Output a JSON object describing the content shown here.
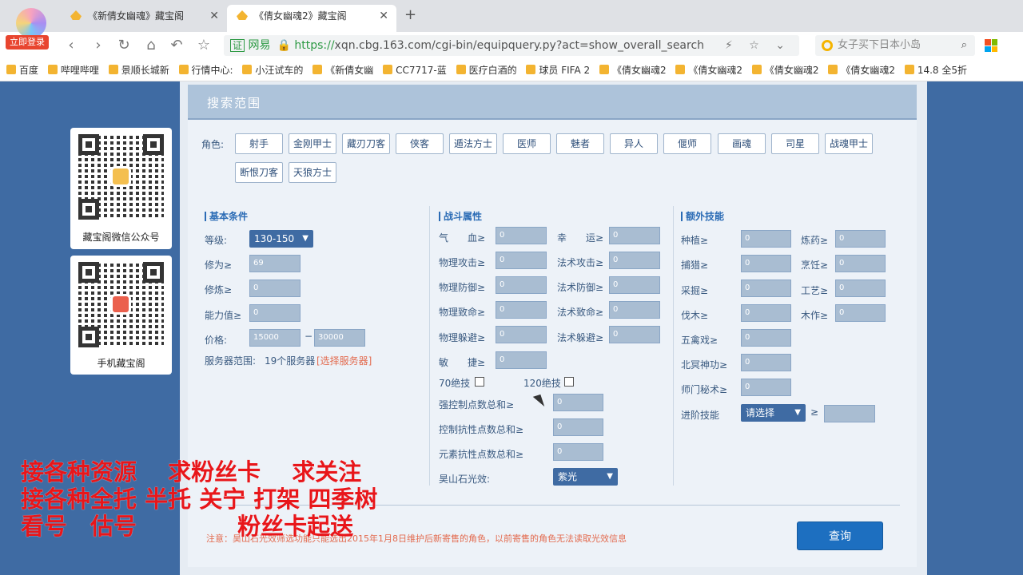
{
  "browser": {
    "login_badge": "立即登录",
    "tabs": [
      {
        "title": "《新倩女幽魂》藏宝阁",
        "close": "✕"
      },
      {
        "title": "《倩女幽魂2》藏宝阁",
        "close": "✕"
      }
    ],
    "newtab": "+",
    "nav": {
      "back": "‹",
      "forward": "›",
      "reload": "↻",
      "home": "⌂",
      "undo": "↶",
      "star": "☆"
    },
    "address": {
      "cert": "证",
      "site": "网易",
      "lock": "🔒",
      "proto": "https://",
      "host_path": "xqn.cbg.163.com/cgi-bin/equipquery.py?act=show_overall_search",
      "icons": "⚡ ☆ ⌄"
    },
    "search": {
      "placeholder": "女子买下日本小岛",
      "icon": "⌕"
    },
    "bookmarks": [
      "百度",
      "哔哩哔哩",
      "景顺长城新",
      "行情中心:",
      "小汪试车的",
      "《新倩女幽",
      "CC7717-蓝",
      "医疗白酒的",
      "球员 FIFA 2",
      "《倩女幽魂2",
      "《倩女幽魂2",
      "《倩女幽魂2",
      "《倩女幽魂2",
      "14.8 全5折"
    ]
  },
  "qr_cards": [
    {
      "label": "藏宝阁微信公众号"
    },
    {
      "label": "手机藏宝阁"
    }
  ],
  "scope": {
    "title": "搜索范围",
    "role_label": "角色:",
    "roles": [
      "射手",
      "金刚甲士",
      "藏刃刀客",
      "侠客",
      "遁法方士",
      "医师",
      "魅者",
      "异人",
      "偃师",
      "画魂",
      "司星",
      "战魂甲士",
      "断恨刀客",
      "天狼方士"
    ]
  },
  "basic": {
    "title": "基本条件",
    "level_label": "等级:",
    "level_value": "130-150",
    "cultivation_label": "修为≥",
    "cultivation_value": "69",
    "practice_label": "修炼≥",
    "practice_value": "0",
    "ability_label": "能力值≥",
    "ability_value": "0",
    "price_label": "价格:",
    "price_min": "15000",
    "price_sep": "−",
    "price_max": "30000",
    "server_label": "服务器范围:",
    "server_count": "19个服务器",
    "server_choose": "[选择服务器]"
  },
  "combat": {
    "title": "战斗属性",
    "left": [
      {
        "label": "气　　血≥",
        "value": "0"
      },
      {
        "label": "物理攻击≥",
        "value": "0"
      },
      {
        "label": "物理防御≥",
        "value": "0"
      },
      {
        "label": "物理致命≥",
        "value": "0"
      },
      {
        "label": "物理躲避≥",
        "value": "0"
      },
      {
        "label": "敏　　捷≥",
        "value": "0"
      }
    ],
    "right": [
      {
        "label": "幸　　运≥",
        "value": "0"
      },
      {
        "label": "法术攻击≥",
        "value": "0"
      },
      {
        "label": "法术防御≥",
        "value": "0"
      },
      {
        "label": "法术致命≥",
        "value": "0"
      },
      {
        "label": "法术躲避≥",
        "value": "0"
      }
    ],
    "skill70": "70绝技",
    "skill120": "120绝技",
    "control_label": "强控制点数总和≥",
    "control_value": "0",
    "resist_label": "控制抗性点数总和≥",
    "resist_value": "0",
    "element_label": "元素抗性点数总和≥",
    "element_value": "0",
    "haoshan_label": "昊山石光效:",
    "haoshan_value": "紫光"
  },
  "extra": {
    "title": "额外技能",
    "left": [
      {
        "label": "种植≥",
        "value": "0"
      },
      {
        "label": "捕猎≥",
        "value": "0"
      },
      {
        "label": "采掘≥",
        "value": "0"
      },
      {
        "label": "伐木≥",
        "value": "0"
      },
      {
        "label": "五禽戏≥",
        "value": "0"
      },
      {
        "label": "北冥神功≥",
        "value": "0"
      },
      {
        "label": "师门秘术≥",
        "value": "0"
      }
    ],
    "right": [
      {
        "label": "炼药≥",
        "value": "0"
      },
      {
        "label": "烹饪≥",
        "value": "0"
      },
      {
        "label": "工艺≥",
        "value": "0"
      },
      {
        "label": "木作≥",
        "value": "0"
      }
    ],
    "advanced_label": "进阶技能",
    "advanced_value": "请选择",
    "advanced_op": "≥"
  },
  "note": "注意：昊山石光效筛选功能只能选出2015年1月8日维护后新寄售的角色，以前寄售的角色无法读取光效信息",
  "submit": "查询",
  "overlay": {
    "line1": "接各种资源　 求粉丝卡　 求关注",
    "line2": "接各种全托 半托 关宁 打架 四季树",
    "line3": "看号　估号　　　　 粉丝卡起送"
  }
}
